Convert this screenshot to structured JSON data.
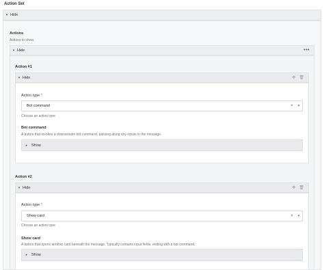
{
  "page": {
    "title": "Action Set"
  },
  "top_hide": {
    "label": "Hide"
  },
  "actions": {
    "title": "Actions",
    "subtitle": "Actions to show.",
    "hide_label": "Hide",
    "more_icon": "more-horizontal-icon"
  },
  "action1": {
    "title": "Action #1",
    "hide_label": "Hide",
    "field_label": "Action type",
    "required": "*",
    "value": "Bot command",
    "help": "Choose an action type.",
    "section_title": "Bot command",
    "section_desc": "A button that invokes a downstream bot command, passing along any inputs in the message.",
    "show_label": "Show"
  },
  "action2": {
    "title": "Action #2",
    "hide_label": "Hide",
    "field_label": "Action type",
    "required": "*",
    "value": "Show card",
    "help": "Choose an action type.",
    "section_title": "Show card",
    "section_desc": "A button that opens another card beneath the message. Typically contains input fields, ending with a bot command.",
    "show_label": "Show"
  }
}
